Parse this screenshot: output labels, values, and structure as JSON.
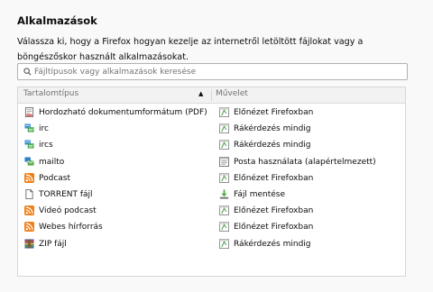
{
  "heading": "Alkalmazások",
  "description": "Válassza ki, hogy a Firefox hogyan kezelje az internetről letöltött fájlokat vagy a böngészőskor használt alkalmazásokat.",
  "search": {
    "placeholder": "Fájltípusok vagy alkalmazások keresése",
    "value": ""
  },
  "table": {
    "headers": {
      "type": "Tartalomtípus",
      "action": "Művelet"
    },
    "sort_indicator": "▲",
    "rows": [
      {
        "type": "Hordozható dokumentumformátum (PDF)",
        "type_icon": "pdf-icon",
        "action": "Előnézet Firefoxban",
        "action_icon": "preview-icon"
      },
      {
        "type": "irc",
        "type_icon": "chat-icon",
        "action": "Rákérdezés mindig",
        "action_icon": "ask-icon"
      },
      {
        "type": "ircs",
        "type_icon": "chat-icon",
        "action": "Rákérdezés mindig",
        "action_icon": "ask-icon"
      },
      {
        "type": "mailto",
        "type_icon": "mail-icon",
        "action": "Posta használata (alapértelmezett)",
        "action_icon": "app-icon"
      },
      {
        "type": "Podcast",
        "type_icon": "feed-icon",
        "action": "Előnézet Firefoxban",
        "action_icon": "preview-icon"
      },
      {
        "type": "TORRENT fájl",
        "type_icon": "file-icon",
        "action": "Fájl mentése",
        "action_icon": "save-icon"
      },
      {
        "type": "Videó podcast",
        "type_icon": "feed-icon",
        "action": "Előnézet Firefoxban",
        "action_icon": "preview-icon"
      },
      {
        "type": "Webes hírforrás",
        "type_icon": "feed-icon",
        "action": "Előnézet Firefoxban",
        "action_icon": "preview-icon"
      },
      {
        "type": "ZIP fájl",
        "type_icon": "archive-icon",
        "action": "Rákérdezés mindig",
        "action_icon": "ask-icon"
      }
    ]
  },
  "colors": {
    "feed": "#f0801b",
    "ask": "#58a55c",
    "border": "#b1b1b3",
    "header_bg": "#f2f2f2"
  }
}
